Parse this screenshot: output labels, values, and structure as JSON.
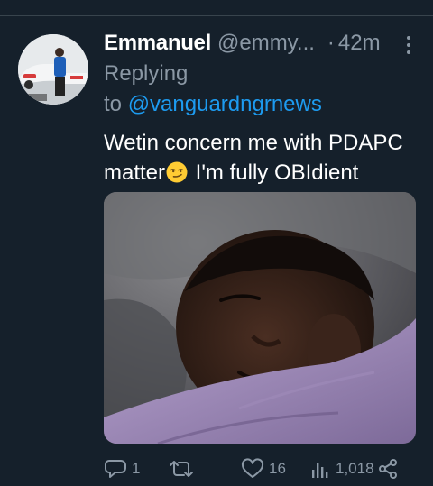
{
  "tweet": {
    "author_name": "Emmanuel",
    "author_handle": "@emmy...",
    "separator": "·",
    "time": "42m",
    "reply_label": "Replying",
    "reply_to_prefix": "to",
    "reply_to_handle": "@vanguardngrnews",
    "text_line1": "Wetin concern me with PDAPC",
    "text_line2_before_emoji": "matter",
    "text_line2_after_emoji": " I'm fully OBIdient",
    "emoji": "smirking-face"
  },
  "actions": {
    "reply_count": "1",
    "retweet_count": "",
    "like_count": "16",
    "views_count": "1,018"
  },
  "icons": {
    "reply": "reply-icon",
    "retweet": "retweet-icon",
    "like": "heart-icon",
    "views": "views-icon",
    "share": "share-icon",
    "more": "more-vertical-icon"
  },
  "colors": {
    "background": "#15202b",
    "divider": "#38444d",
    "secondary_text": "#8b98a5",
    "link": "#1d9bf0",
    "primary_text": "#ffffff"
  }
}
